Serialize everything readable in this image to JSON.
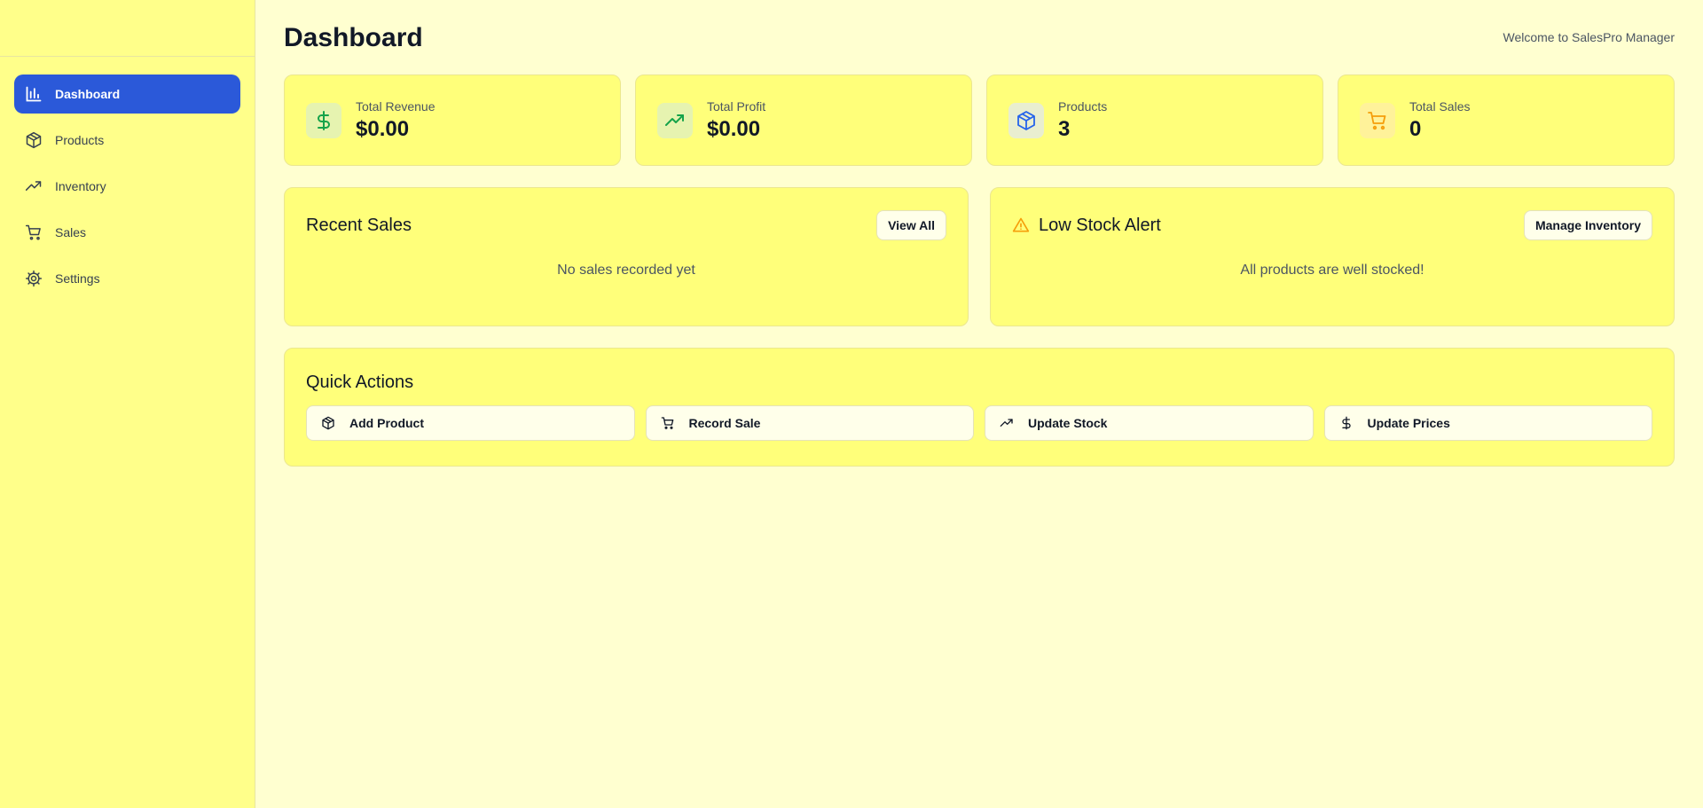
{
  "sidebar": {
    "items": [
      {
        "label": "Dashboard",
        "icon": "bar-chart-icon",
        "active": true
      },
      {
        "label": "Products",
        "icon": "package-icon"
      },
      {
        "label": "Inventory",
        "icon": "trending-up-icon"
      },
      {
        "label": "Sales",
        "icon": "cart-icon"
      },
      {
        "label": "Settings",
        "icon": "gear-icon"
      }
    ]
  },
  "header": {
    "title": "Dashboard",
    "welcome": "Welcome to SalesPro Manager"
  },
  "stats": [
    {
      "label": "Total Revenue",
      "value": "$0.00",
      "icon": "dollar-icon",
      "color": "#16a34a"
    },
    {
      "label": "Total Profit",
      "value": "$0.00",
      "icon": "trending-up-icon",
      "color": "#16a34a"
    },
    {
      "label": "Products",
      "value": "3",
      "icon": "package-icon",
      "color": "#2563eb"
    },
    {
      "label": "Total Sales",
      "value": "0",
      "icon": "cart-icon",
      "color": "#f59e0b"
    }
  ],
  "recent_sales": {
    "title": "Recent Sales",
    "button": "View All",
    "empty": "No sales recorded yet"
  },
  "low_stock": {
    "title": "Low Stock Alert",
    "button": "Manage Inventory",
    "empty": "All products are well stocked!",
    "icon": "warning-icon"
  },
  "quick_actions": {
    "title": "Quick Actions",
    "items": [
      {
        "label": "Add Product",
        "icon": "package-icon"
      },
      {
        "label": "Record Sale",
        "icon": "cart-icon"
      },
      {
        "label": "Update Stock",
        "icon": "trending-up-icon"
      },
      {
        "label": "Update Prices",
        "icon": "dollar-icon"
      }
    ]
  },
  "colors": {
    "accent": "#2b59d9",
    "background": "#ffffd0",
    "sidebar": "#ffff8a",
    "card": "#ffff7a"
  }
}
